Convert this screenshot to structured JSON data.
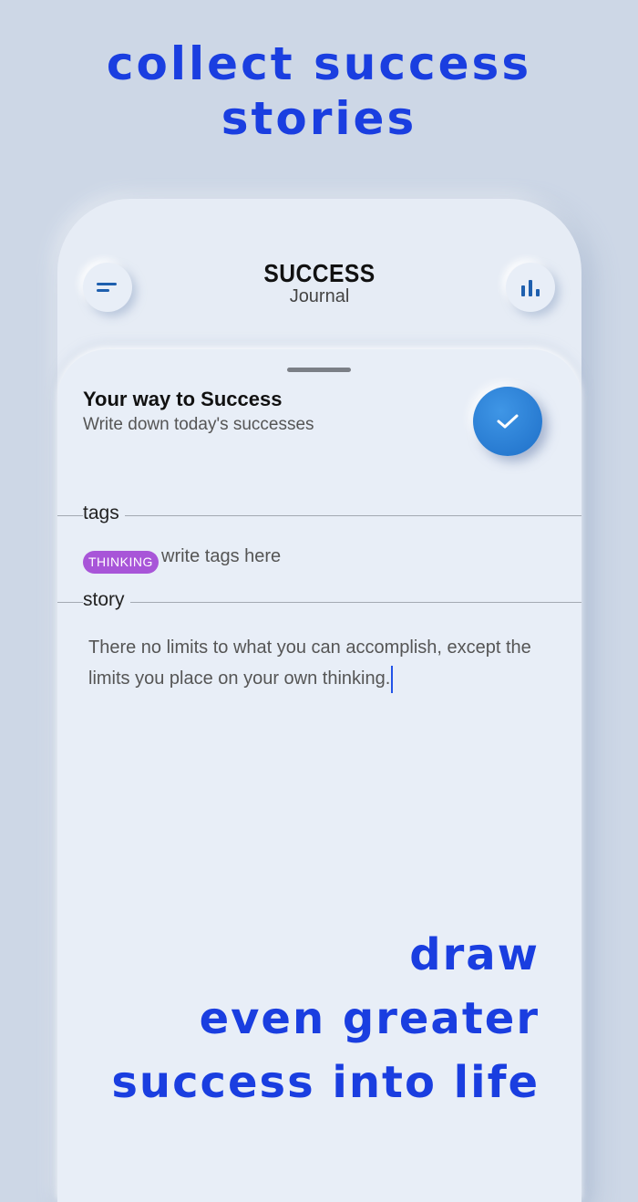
{
  "promo": {
    "top_line1": "collect success",
    "top_line2": "stories",
    "bottom_line1": "draw",
    "bottom_line2": "even greater",
    "bottom_line3": "success into life"
  },
  "app": {
    "title": "SUCCESS",
    "subtitle": "Journal",
    "menu_icon": "menu-icon",
    "stats_icon": "bar-chart-icon"
  },
  "entry": {
    "title": "Your way to Success",
    "subtitle": "Write down today's successes",
    "confirm_icon": "checkmark-icon"
  },
  "tags": {
    "label": "tags",
    "chips": [
      "THINKING"
    ],
    "placeholder": "write tags here"
  },
  "story": {
    "label": "story",
    "text": "There no limits to what you can accomplish, except the limits you place on your own thinking."
  },
  "colors": {
    "accent": "#1a3ee0",
    "tag": "#a855d8",
    "confirm": "#2a7fd6"
  }
}
